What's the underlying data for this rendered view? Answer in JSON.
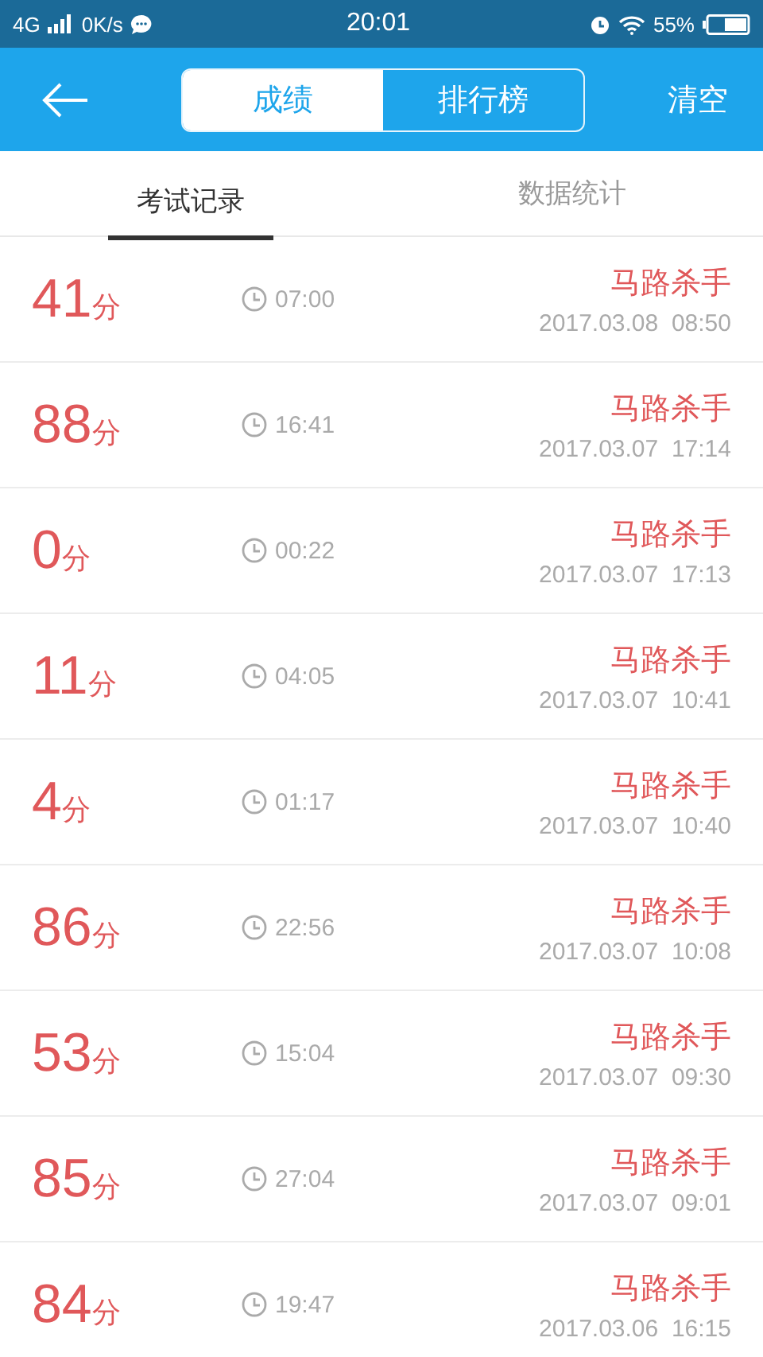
{
  "status_bar": {
    "network": "4G",
    "speed": "0K/s",
    "time": "20:01",
    "battery": "55%"
  },
  "header": {
    "segments": [
      {
        "label": "成绩",
        "selected": true
      },
      {
        "label": "排行榜",
        "selected": false
      }
    ],
    "action": "清空"
  },
  "tabs": [
    {
      "label": "考试记录",
      "selected": true
    },
    {
      "label": "数据统计",
      "selected": false
    }
  ],
  "records": [
    {
      "score": "41",
      "unit": "分",
      "duration": "07:00",
      "title": "马路杀手",
      "date": "2017.03.08  08:50"
    },
    {
      "score": "88",
      "unit": "分",
      "duration": "16:41",
      "title": "马路杀手",
      "date": "2017.03.07  17:14"
    },
    {
      "score": "0",
      "unit": "分",
      "duration": "00:22",
      "title": "马路杀手",
      "date": "2017.03.07  17:13"
    },
    {
      "score": "11",
      "unit": "分",
      "duration": "04:05",
      "title": "马路杀手",
      "date": "2017.03.07  10:41"
    },
    {
      "score": "4",
      "unit": "分",
      "duration": "01:17",
      "title": "马路杀手",
      "date": "2017.03.07  10:40"
    },
    {
      "score": "86",
      "unit": "分",
      "duration": "22:56",
      "title": "马路杀手",
      "date": "2017.03.07  10:08"
    },
    {
      "score": "53",
      "unit": "分",
      "duration": "15:04",
      "title": "马路杀手",
      "date": "2017.03.07  09:30"
    },
    {
      "score": "85",
      "unit": "分",
      "duration": "27:04",
      "title": "马路杀手",
      "date": "2017.03.07  09:01"
    },
    {
      "score": "84",
      "unit": "分",
      "duration": "19:47",
      "title": "马路杀手",
      "date": "2017.03.06  16:15"
    }
  ]
}
